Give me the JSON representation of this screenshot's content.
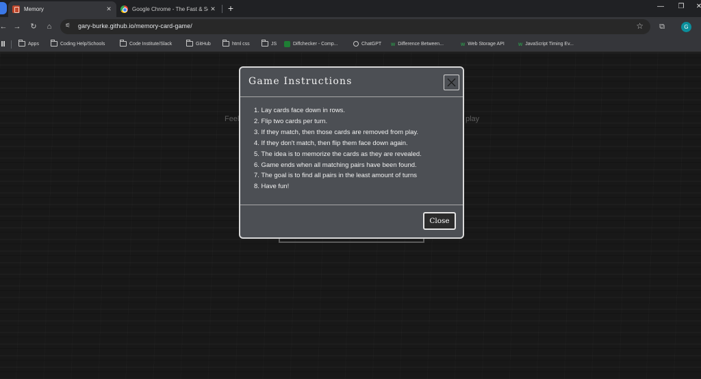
{
  "browser": {
    "tabs": [
      {
        "title": "Memory",
        "icon": "memory-favicon",
        "active": true
      },
      {
        "title": "Google Chrome - The Fast & Se",
        "icon": "chrome-favicon",
        "active": false
      }
    ],
    "url": "gary-burke.github.io/memory-card-game/",
    "profile_initial": "G",
    "bookmarks": [
      {
        "label": "Apps",
        "icon": "grid-icon"
      },
      {
        "label": "Coding Help/Schools",
        "icon": "folder-icon"
      },
      {
        "label": "Code Institute/Slack",
        "icon": "folder-icon"
      },
      {
        "label": "GitHub",
        "icon": "folder-icon"
      },
      {
        "label": "html css",
        "icon": "folder-icon"
      },
      {
        "label": "JS",
        "icon": "folder-icon"
      },
      {
        "label": "Diffchecker - Comp...",
        "icon": "diffchecker-icon"
      },
      {
        "label": "ChatGPT",
        "icon": "chatgpt-icon"
      },
      {
        "label": "Difference Between...",
        "icon": "w-icon"
      },
      {
        "label": "Web Storage API",
        "icon": "w-icon"
      },
      {
        "label": "JavaScript Timing Ev...",
        "icon": "w-icon"
      }
    ]
  },
  "page": {
    "background_text_left": "Feel",
    "background_text_right": "play"
  },
  "modal": {
    "title": "Game Instructions",
    "instructions": [
      "1. Lay cards face down in rows.",
      "2. Flip two cards per turn.",
      "3. If they match, then those cards are removed from play.",
      "4. If they don't match, then flip them face down again.",
      "5. The idea is to memorize the cards as they are revealed.",
      "6. Game ends when all matching pairs have been found.",
      "7. The goal is to find all pairs in the least amount of turns",
      "8. Have fun!"
    ],
    "close_label": "Close"
  },
  "colors": {
    "modal_bg": "#4c4f54",
    "modal_border": "#d9d9d9",
    "close_button_bg": "#2b2b2b",
    "page_bg": "#181818"
  }
}
